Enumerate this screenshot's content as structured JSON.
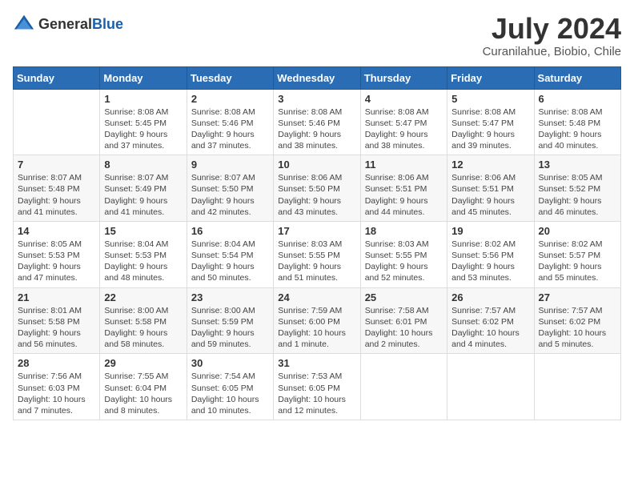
{
  "logo": {
    "text_general": "General",
    "text_blue": "Blue"
  },
  "title": {
    "month_year": "July 2024",
    "location": "Curanilahue, Biobio, Chile"
  },
  "weekdays": [
    "Sunday",
    "Monday",
    "Tuesday",
    "Wednesday",
    "Thursday",
    "Friday",
    "Saturday"
  ],
  "weeks": [
    [
      {
        "day": "",
        "info": ""
      },
      {
        "day": "1",
        "info": "Sunrise: 8:08 AM\nSunset: 5:45 PM\nDaylight: 9 hours\nand 37 minutes."
      },
      {
        "day": "2",
        "info": "Sunrise: 8:08 AM\nSunset: 5:46 PM\nDaylight: 9 hours\nand 37 minutes."
      },
      {
        "day": "3",
        "info": "Sunrise: 8:08 AM\nSunset: 5:46 PM\nDaylight: 9 hours\nand 38 minutes."
      },
      {
        "day": "4",
        "info": "Sunrise: 8:08 AM\nSunset: 5:47 PM\nDaylight: 9 hours\nand 38 minutes."
      },
      {
        "day": "5",
        "info": "Sunrise: 8:08 AM\nSunset: 5:47 PM\nDaylight: 9 hours\nand 39 minutes."
      },
      {
        "day": "6",
        "info": "Sunrise: 8:08 AM\nSunset: 5:48 PM\nDaylight: 9 hours\nand 40 minutes."
      }
    ],
    [
      {
        "day": "7",
        "info": "Sunrise: 8:07 AM\nSunset: 5:48 PM\nDaylight: 9 hours\nand 41 minutes."
      },
      {
        "day": "8",
        "info": "Sunrise: 8:07 AM\nSunset: 5:49 PM\nDaylight: 9 hours\nand 41 minutes."
      },
      {
        "day": "9",
        "info": "Sunrise: 8:07 AM\nSunset: 5:50 PM\nDaylight: 9 hours\nand 42 minutes."
      },
      {
        "day": "10",
        "info": "Sunrise: 8:06 AM\nSunset: 5:50 PM\nDaylight: 9 hours\nand 43 minutes."
      },
      {
        "day": "11",
        "info": "Sunrise: 8:06 AM\nSunset: 5:51 PM\nDaylight: 9 hours\nand 44 minutes."
      },
      {
        "day": "12",
        "info": "Sunrise: 8:06 AM\nSunset: 5:51 PM\nDaylight: 9 hours\nand 45 minutes."
      },
      {
        "day": "13",
        "info": "Sunrise: 8:05 AM\nSunset: 5:52 PM\nDaylight: 9 hours\nand 46 minutes."
      }
    ],
    [
      {
        "day": "14",
        "info": "Sunrise: 8:05 AM\nSunset: 5:53 PM\nDaylight: 9 hours\nand 47 minutes."
      },
      {
        "day": "15",
        "info": "Sunrise: 8:04 AM\nSunset: 5:53 PM\nDaylight: 9 hours\nand 48 minutes."
      },
      {
        "day": "16",
        "info": "Sunrise: 8:04 AM\nSunset: 5:54 PM\nDaylight: 9 hours\nand 50 minutes."
      },
      {
        "day": "17",
        "info": "Sunrise: 8:03 AM\nSunset: 5:55 PM\nDaylight: 9 hours\nand 51 minutes."
      },
      {
        "day": "18",
        "info": "Sunrise: 8:03 AM\nSunset: 5:55 PM\nDaylight: 9 hours\nand 52 minutes."
      },
      {
        "day": "19",
        "info": "Sunrise: 8:02 AM\nSunset: 5:56 PM\nDaylight: 9 hours\nand 53 minutes."
      },
      {
        "day": "20",
        "info": "Sunrise: 8:02 AM\nSunset: 5:57 PM\nDaylight: 9 hours\nand 55 minutes."
      }
    ],
    [
      {
        "day": "21",
        "info": "Sunrise: 8:01 AM\nSunset: 5:58 PM\nDaylight: 9 hours\nand 56 minutes."
      },
      {
        "day": "22",
        "info": "Sunrise: 8:00 AM\nSunset: 5:58 PM\nDaylight: 9 hours\nand 58 minutes."
      },
      {
        "day": "23",
        "info": "Sunrise: 8:00 AM\nSunset: 5:59 PM\nDaylight: 9 hours\nand 59 minutes."
      },
      {
        "day": "24",
        "info": "Sunrise: 7:59 AM\nSunset: 6:00 PM\nDaylight: 10 hours\nand 1 minute."
      },
      {
        "day": "25",
        "info": "Sunrise: 7:58 AM\nSunset: 6:01 PM\nDaylight: 10 hours\nand 2 minutes."
      },
      {
        "day": "26",
        "info": "Sunrise: 7:57 AM\nSunset: 6:02 PM\nDaylight: 10 hours\nand 4 minutes."
      },
      {
        "day": "27",
        "info": "Sunrise: 7:57 AM\nSunset: 6:02 PM\nDaylight: 10 hours\nand 5 minutes."
      }
    ],
    [
      {
        "day": "28",
        "info": "Sunrise: 7:56 AM\nSunset: 6:03 PM\nDaylight: 10 hours\nand 7 minutes."
      },
      {
        "day": "29",
        "info": "Sunrise: 7:55 AM\nSunset: 6:04 PM\nDaylight: 10 hours\nand 8 minutes."
      },
      {
        "day": "30",
        "info": "Sunrise: 7:54 AM\nSunset: 6:05 PM\nDaylight: 10 hours\nand 10 minutes."
      },
      {
        "day": "31",
        "info": "Sunrise: 7:53 AM\nSunset: 6:05 PM\nDaylight: 10 hours\nand 12 minutes."
      },
      {
        "day": "",
        "info": ""
      },
      {
        "day": "",
        "info": ""
      },
      {
        "day": "",
        "info": ""
      }
    ]
  ]
}
